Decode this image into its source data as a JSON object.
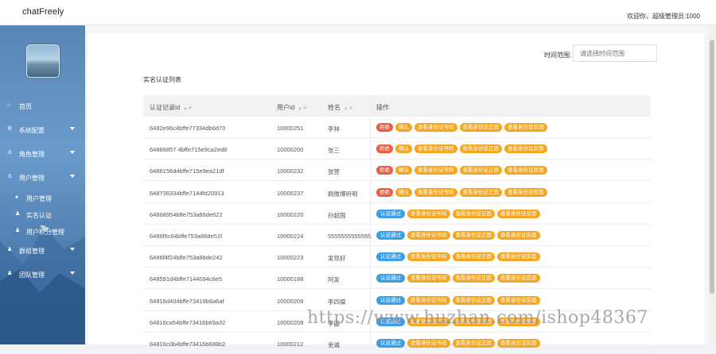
{
  "app": {
    "title": "chatFreely",
    "welcome": "欢迎你，超级管理员:1000"
  },
  "sidebar": {
    "items": [
      {
        "label": "首页",
        "icon": "home-icon",
        "glyph": "⌂"
      },
      {
        "label": "系统配置",
        "icon": "gear-icon",
        "glyph": "⚙"
      },
      {
        "label": "角色管理",
        "icon": "user-icon",
        "glyph": "♙"
      },
      {
        "label": "用户管理",
        "icon": "user-icon",
        "glyph": "♙"
      },
      {
        "label": "用户管理",
        "icon": "user-icon",
        "glyph": "●"
      },
      {
        "label": "实名认证",
        "icon": "users-icon",
        "glyph": "♟"
      },
      {
        "label": "用户积分管理",
        "icon": "users-icon",
        "glyph": "♟"
      },
      {
        "label": "群组管理",
        "icon": "group-icon",
        "glyph": "♟"
      },
      {
        "label": "团队管理",
        "icon": "group-icon",
        "glyph": "♟"
      }
    ]
  },
  "filter": {
    "time_label": "时间范围:",
    "time_placeholder": "请选择时间范围"
  },
  "list": {
    "title": "实名认证列表",
    "headers": [
      "认证记录id",
      "用户id",
      "姓名",
      "操作"
    ],
    "rows": [
      {
        "id": "6482e96c4bffe77334db6d70",
        "uid": "10000251",
        "name": "李林"
      },
      {
        "id": "64866857 4bffe715e9ca2ed8",
        "uid": "10000200",
        "name": "张三"
      },
      {
        "id": "6488156d4bffe715e9ea21df",
        "uid": "10000232",
        "name": "张营"
      },
      {
        "id": "648736334bffe7144fd20913",
        "uid": "10000237",
        "name": "刷微博听明"
      },
      {
        "id": "64868954bffe753a86de622",
        "uid": "10000220",
        "name": "孙超国"
      },
      {
        "id": "6486f6c64bffe753a86de51f",
        "uid": "10000224",
        "name": "5555555555555"
      },
      {
        "id": "6486f4f24bffe753a86de242",
        "uid": "10000223",
        "name": "发现好"
      },
      {
        "id": "648591d4bffe7144094c8e5",
        "uid": "10000188",
        "name": "阿发"
      },
      {
        "id": "64816d404bffe73416b6a6af",
        "uid": "10000209",
        "name": "李四媒"
      },
      {
        "id": "64816ca54bffe73416b69a32",
        "uid": "10000209",
        "name": "李四"
      },
      {
        "id": "64816c0b4bffe73416b688b2",
        "uid": "10000212",
        "name": "金诚"
      }
    ],
    "pending_actions": [
      "拒绝",
      "确认",
      "查看身份证号码",
      "查看身份证正面",
      "查看身份证反面"
    ],
    "approved_actions": [
      "认证通过",
      "查看身份证号码",
      "查看身份证正面",
      "查看身份证反面"
    ]
  },
  "watermark": "https://www.huzhan.com/ishop48367",
  "colors": {
    "reject": "#f05a3a",
    "confirm": "#f5a623",
    "approved": "#3a9fe8"
  }
}
